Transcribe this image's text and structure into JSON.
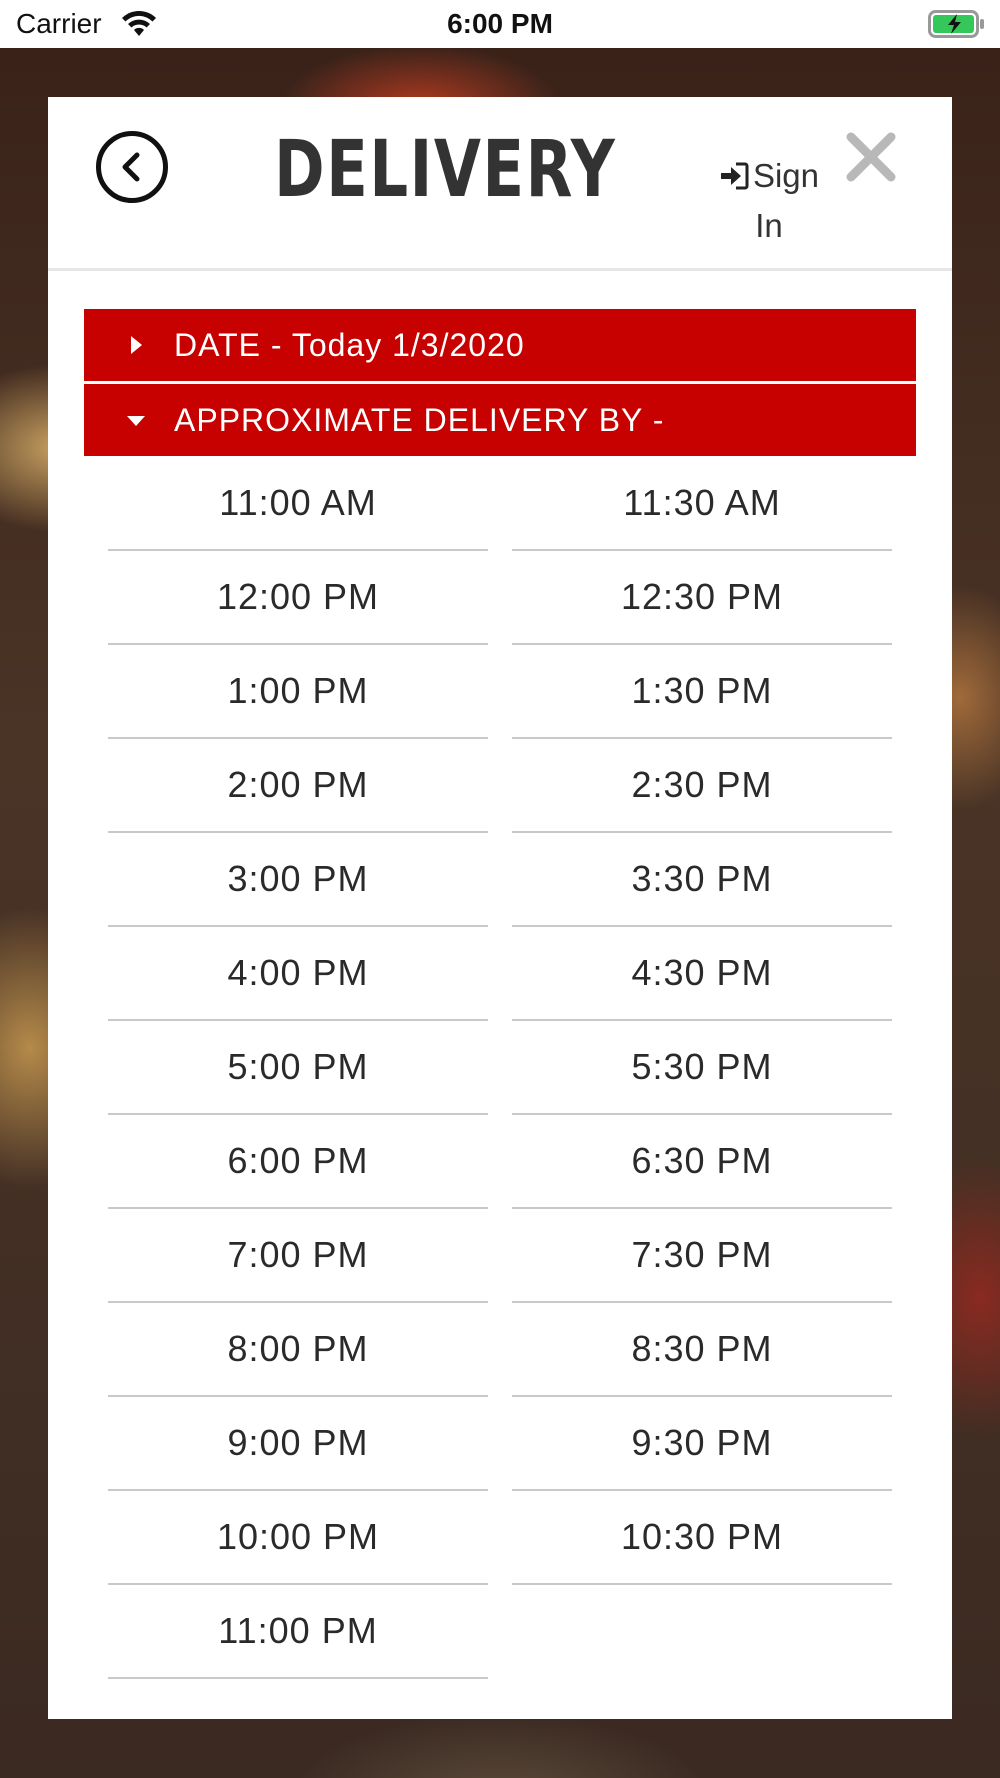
{
  "status_bar": {
    "carrier": "Carrier",
    "time": "6:00 PM",
    "icons": [
      "wifi-icon",
      "battery-charging-icon"
    ]
  },
  "modal": {
    "title": "DELIVERY",
    "sign_in_label": "Sign In",
    "icons": [
      "back-chevron-icon",
      "sign-in-icon",
      "close-icon"
    ],
    "accent_color": "#c70000"
  },
  "date_section": {
    "label": "DATE - Today 1/3/2020",
    "state": "collapsed"
  },
  "time_section": {
    "label": "APPROXIMATE DELIVERY BY -",
    "state": "expanded"
  },
  "time_slots": [
    "11:00 AM",
    "11:30 AM",
    "12:00 PM",
    "12:30 PM",
    "1:00 PM",
    "1:30 PM",
    "2:00 PM",
    "2:30 PM",
    "3:00 PM",
    "3:30 PM",
    "4:00 PM",
    "4:30 PM",
    "5:00 PM",
    "5:30 PM",
    "6:00 PM",
    "6:30 PM",
    "7:00 PM",
    "7:30 PM",
    "8:00 PM",
    "8:30 PM",
    "9:00 PM",
    "9:30 PM",
    "10:00 PM",
    "10:30 PM",
    "11:00 PM"
  ]
}
